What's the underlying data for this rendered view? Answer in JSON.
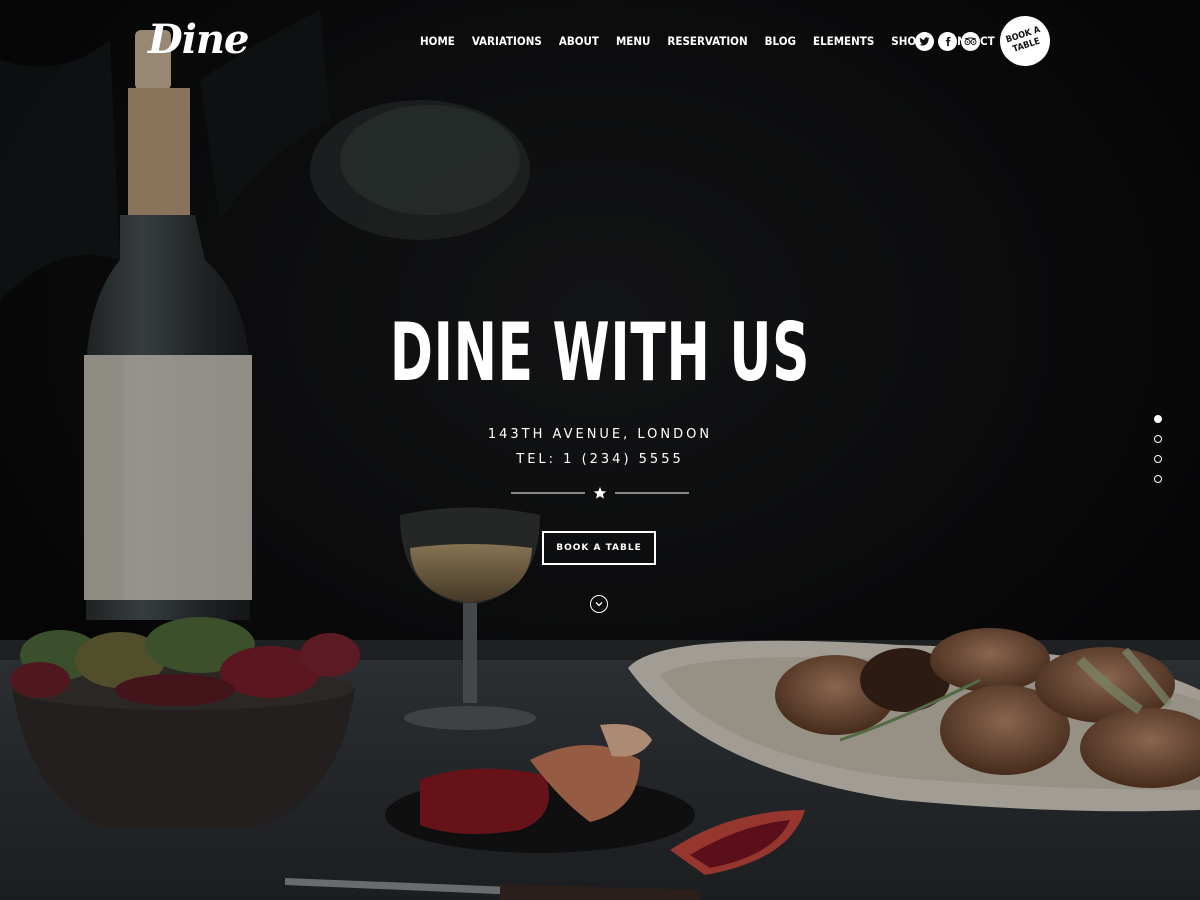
{
  "header": {
    "logo": "Dine",
    "nav": [
      "HOME",
      "VARIATIONS",
      "ABOUT",
      "MENU",
      "RESERVATION",
      "BLOG",
      "ELEMENTS",
      "SHOP",
      "CONTACT"
    ],
    "social_icons": [
      "twitter-icon",
      "facebook-icon",
      "tripadvisor-icon"
    ],
    "book_circle_label": "BOOK A TABLE"
  },
  "hero": {
    "title": "DINE WITH US",
    "address": "143TH AVENUE, LONDON",
    "phone": "TEL: 1 (234) 5555",
    "button_label": "BOOK A TABLE"
  },
  "slider": {
    "count": 4,
    "active": 1
  },
  "colors": {
    "background": "#0b0b0c",
    "text": "#ffffff"
  }
}
